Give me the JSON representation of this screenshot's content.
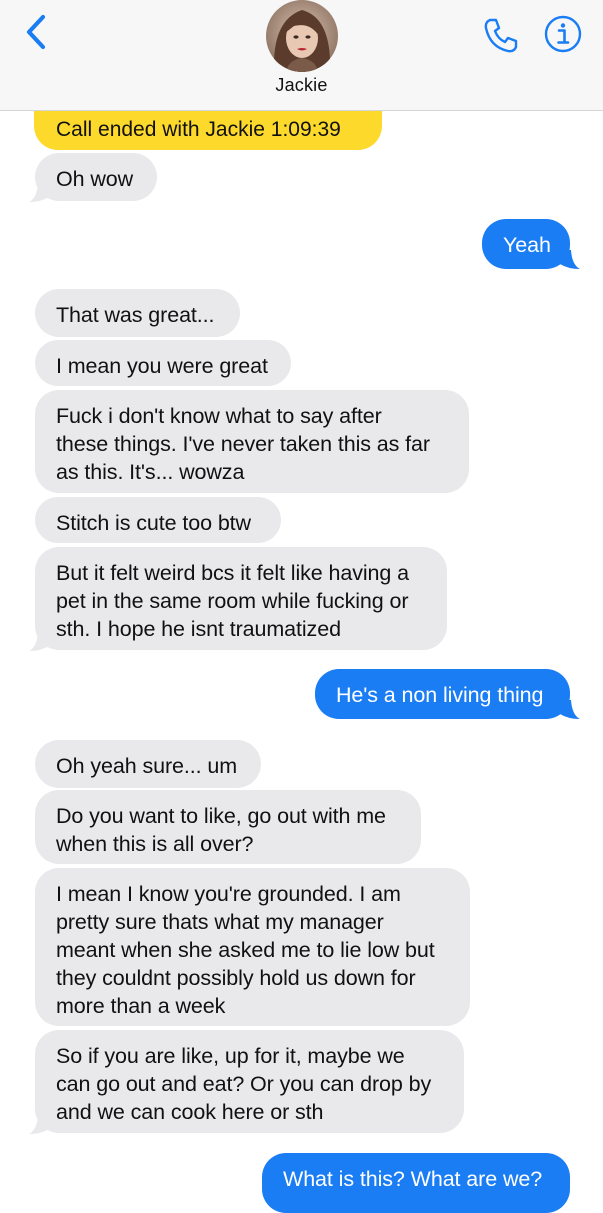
{
  "header": {
    "contact_name": "Jackie",
    "back_icon": "chevron-left-icon",
    "call_icon": "phone-icon",
    "info_icon": "info-icon",
    "accent": "#1a7df4"
  },
  "call_note": "Call ended with Jackie 1:09:39",
  "messages": [
    {
      "dir": "in",
      "text": "Oh wow"
    },
    {
      "dir": "out",
      "text": "Yeah"
    },
    {
      "dir": "in",
      "text": "That was great..."
    },
    {
      "dir": "in",
      "text": "I mean you were great"
    },
    {
      "dir": "in",
      "lines": [
        "Fuck i don't know what to say after",
        "these things. I've never taken this as far",
        "as this. It's... wowza"
      ]
    },
    {
      "dir": "in",
      "text": "Stitch is cute too btw"
    },
    {
      "dir": "in",
      "lines": [
        "But it felt weird bcs it felt like having a",
        "pet in the same room while fucking or",
        "sth. I hope he isnt traumatized"
      ]
    },
    {
      "dir": "out",
      "text": "He's a non living thing"
    },
    {
      "dir": "in",
      "text": "Oh yeah sure... um"
    },
    {
      "dir": "in",
      "lines": [
        "Do you want to like, go out with me",
        "when this is all over?"
      ]
    },
    {
      "dir": "in",
      "lines": [
        "I mean I know you're grounded. I am",
        "pretty sure thats what my manager",
        "meant when she asked me to lie low but",
        "they couldnt possibly hold us down for",
        "more than a week"
      ]
    },
    {
      "dir": "in",
      "lines": [
        "So if you are like, up for it, maybe we",
        "can go out and eat? Or you can drop by",
        "and we can cook here or sth"
      ]
    },
    {
      "dir": "out",
      "text": "What is this? What are we?"
    }
  ]
}
